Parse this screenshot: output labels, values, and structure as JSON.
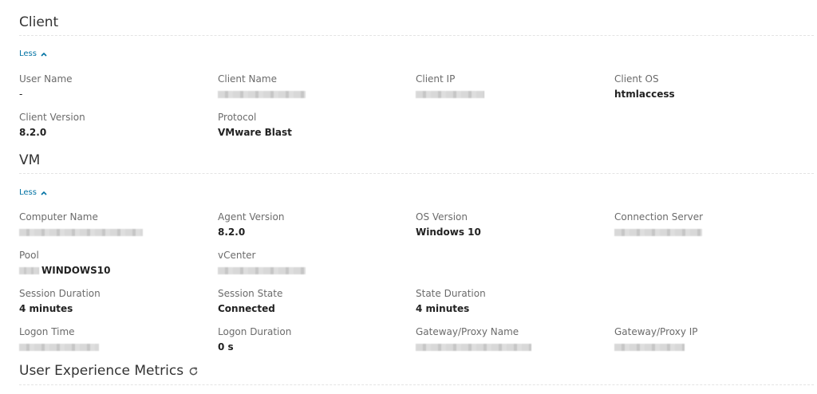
{
  "client": {
    "title": "Client",
    "toggle_label": "Less",
    "fields": {
      "user_name": {
        "label": "User Name",
        "value": "-"
      },
      "client_name": {
        "label": "Client Name"
      },
      "client_ip": {
        "label": "Client IP"
      },
      "client_os": {
        "label": "Client OS",
        "value": "htmlaccess"
      },
      "client_version": {
        "label": "Client Version",
        "value": "8.2.0"
      },
      "protocol": {
        "label": "Protocol",
        "value": "VMware Blast"
      }
    }
  },
  "vm": {
    "title": "VM",
    "toggle_label": "Less",
    "fields": {
      "computer_name": {
        "label": "Computer Name"
      },
      "agent_version": {
        "label": "Agent Version",
        "value": "8.2.0"
      },
      "os_version": {
        "label": "OS Version",
        "value": "Windows 10"
      },
      "connection_server": {
        "label": "Connection Server"
      },
      "pool": {
        "label": "Pool",
        "value": "WINDOWS10"
      },
      "vcenter": {
        "label": "vCenter"
      },
      "session_duration": {
        "label": "Session Duration",
        "value": "4 minutes"
      },
      "session_state": {
        "label": "Session State",
        "value": "Connected"
      },
      "state_duration": {
        "label": "State Duration",
        "value": "4 minutes"
      },
      "logon_time": {
        "label": "Logon Time"
      },
      "logon_duration": {
        "label": "Logon Duration",
        "value": "0 s"
      },
      "gateway_proxy_name": {
        "label": "Gateway/Proxy Name"
      },
      "gateway_proxy_ip": {
        "label": "Gateway/Proxy IP"
      }
    }
  },
  "uem": {
    "title": "User Experience Metrics",
    "refresh_icon": "refresh-icon"
  },
  "colors": {
    "link": "#0072a3",
    "label": "#6b6b6b",
    "value": "#222222",
    "rule": "#e4e4e4"
  }
}
